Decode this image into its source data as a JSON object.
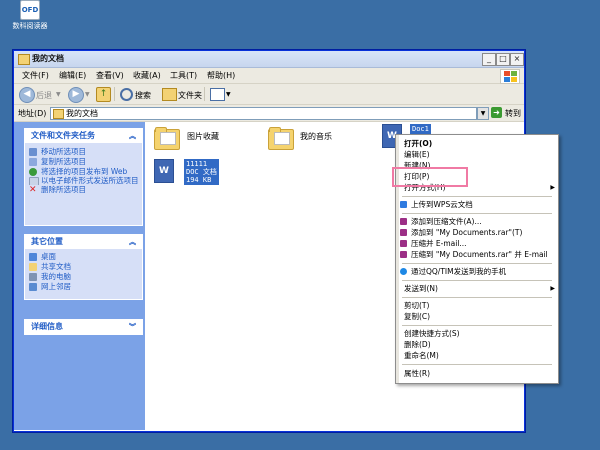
{
  "desktop": {
    "icon_text": "OFD",
    "icon_label": "数科阅读器"
  },
  "window": {
    "title": "我的文档",
    "buttons": {
      "minimize": "_",
      "maximize": "□",
      "close": "×"
    }
  },
  "menubar": [
    "文件(F)",
    "编辑(E)",
    "查看(V)",
    "收藏(A)",
    "工具(T)",
    "帮助(H)"
  ],
  "toolbar": {
    "back": "后退",
    "search": "搜索",
    "folders": "文件夹"
  },
  "address": {
    "label": "地址(D)",
    "value": "我的文档",
    "go": "转到"
  },
  "tasks": {
    "file_tasks": {
      "title": "文件和文件夹任务",
      "items": [
        "移动所选项目",
        "复制所选项目",
        "将选择的项目发布到 Web",
        "以电子邮件形式发送所选项目",
        "删除所选项目"
      ]
    },
    "other_places": {
      "title": "其它位置",
      "items": [
        "桌面",
        "共享文档",
        "我的电脑",
        "网上邻居"
      ]
    },
    "details": {
      "title": "详细信息"
    }
  },
  "files": [
    {
      "name": "图片收藏",
      "kind": "folder"
    },
    {
      "name": "我的音乐",
      "kind": "folder"
    },
    {
      "name": "Doc1",
      "kind": "doc-selected"
    },
    {
      "name": "11111\nDOC 文档\n194 KB",
      "kind": "doc-selected"
    }
  ],
  "context_menu": {
    "items": [
      "打开(O)",
      "编辑(E)",
      "新建(N)",
      "打印(P)",
      "打开方式(H)",
      "上传到WPS云文档",
      "添加到压缩文件(A)...",
      "添加到 \"My Documents.rar\"(T)",
      "压缩并 E-mail...",
      "压缩到 \"My Documents.rar\" 并 E-mail",
      "通过QQ/TIM发送到我的手机",
      "发送到(N)",
      "剪切(T)",
      "复制(C)",
      "创建快捷方式(S)",
      "删除(D)",
      "重命名(M)",
      "属性(R)"
    ]
  },
  "colors": {
    "accent_highlight": "#f07aa4",
    "selection": "#316ac5",
    "task_pane": "#7ba2e7"
  }
}
